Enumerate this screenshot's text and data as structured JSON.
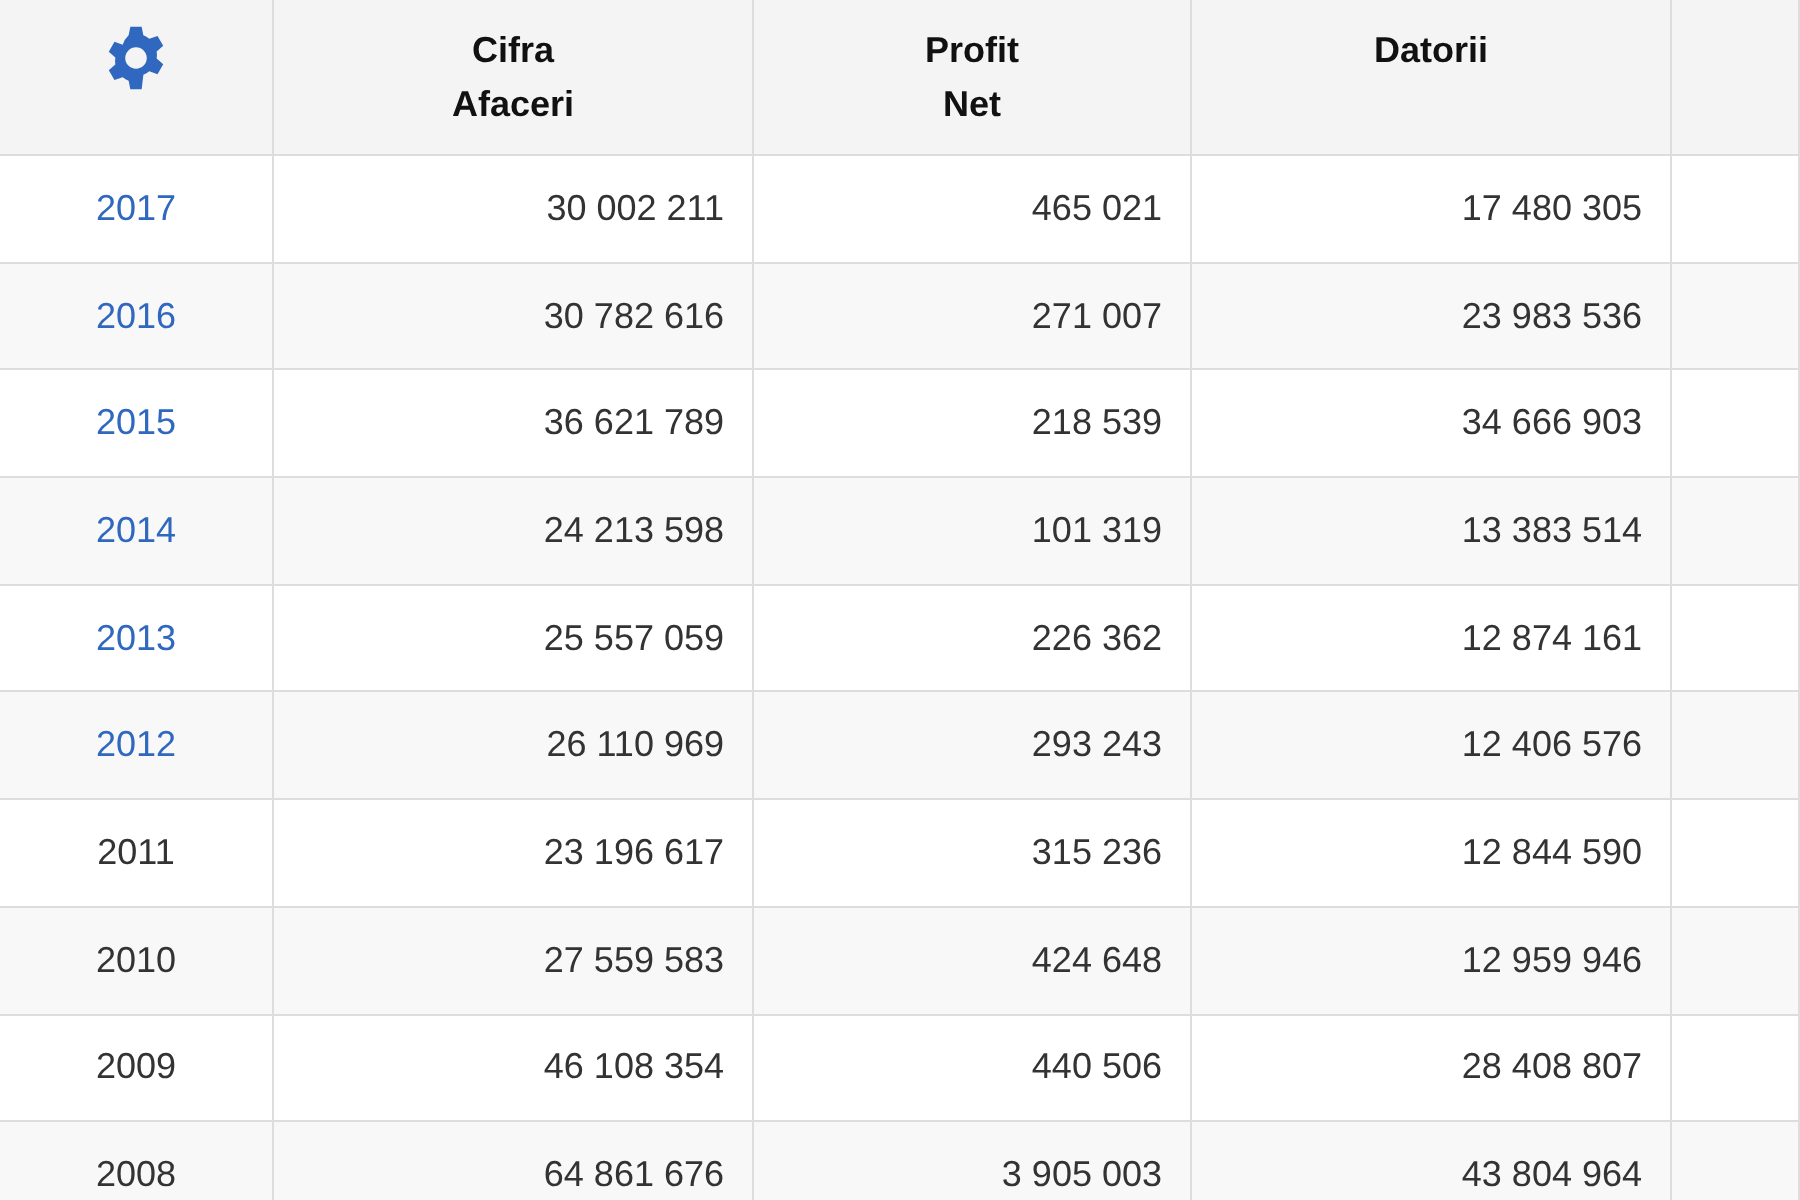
{
  "table": {
    "columns": [
      {
        "kind": "settings"
      },
      {
        "kind": "text",
        "label": "Cifra\nAfaceri"
      },
      {
        "kind": "text",
        "label": "Profit\nNet"
      },
      {
        "kind": "text",
        "label": "Datorii"
      },
      {
        "kind": "empty"
      }
    ],
    "rows": [
      {
        "year": "2017",
        "linked": true,
        "cifra_afaceri": "30 002 211",
        "profit_net": "465 021",
        "datorii": "17 480 305"
      },
      {
        "year": "2016",
        "linked": true,
        "cifra_afaceri": "30 782 616",
        "profit_net": "271 007",
        "datorii": "23 983 536"
      },
      {
        "year": "2015",
        "linked": true,
        "cifra_afaceri": "36 621 789",
        "profit_net": "218 539",
        "datorii": "34 666 903"
      },
      {
        "year": "2014",
        "linked": true,
        "cifra_afaceri": "24 213 598",
        "profit_net": "101 319",
        "datorii": "13 383 514"
      },
      {
        "year": "2013",
        "linked": true,
        "cifra_afaceri": "25 557 059",
        "profit_net": "226 362",
        "datorii": "12 874 161"
      },
      {
        "year": "2012",
        "linked": true,
        "cifra_afaceri": "26 110 969",
        "profit_net": "293 243",
        "datorii": "12 406 576"
      },
      {
        "year": "2011",
        "linked": false,
        "cifra_afaceri": "23 196 617",
        "profit_net": "315 236",
        "datorii": "12 844 590"
      },
      {
        "year": "2010",
        "linked": false,
        "cifra_afaceri": "27 559 583",
        "profit_net": "424 648",
        "datorii": "12 959 946"
      },
      {
        "year": "2009",
        "linked": false,
        "cifra_afaceri": "46 108 354",
        "profit_net": "440 506",
        "datorii": "28 408 807"
      },
      {
        "year": "2008",
        "linked": false,
        "cifra_afaceri": "64 861 676",
        "profit_net": "3 905 003",
        "datorii": "43 804 964"
      }
    ]
  }
}
